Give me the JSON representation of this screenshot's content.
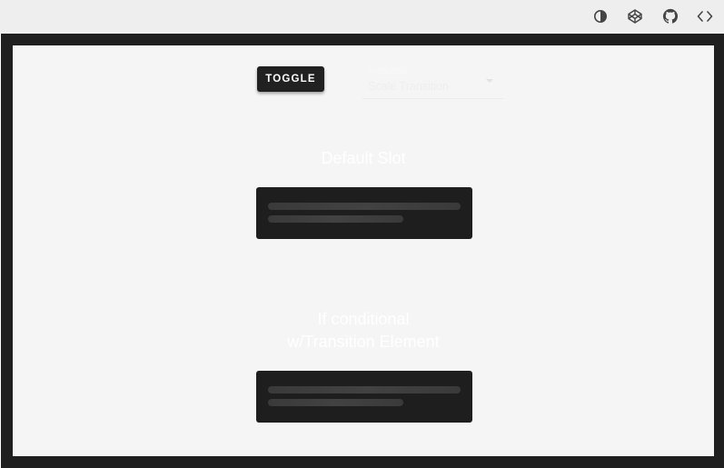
{
  "toolbar": {
    "icons": [
      "theme-toggle-icon",
      "codepen-icon",
      "github-icon",
      "code-icon"
    ]
  },
  "controls": {
    "toggle_label": "TOGGLE",
    "select_label": "Transition",
    "select_value": "Scale Transition"
  },
  "sections": [
    {
      "title_line1": "Default Slot",
      "title_line2": ""
    },
    {
      "title_line1": "If conditional",
      "title_line2": "w/Transition Element"
    }
  ],
  "colors": {
    "frame": "#1f1f1f",
    "stage": "#f5f5f5",
    "button": "#212121",
    "skeleton": "#1e1e1e",
    "skeleton_line": "#3d3d3d"
  }
}
